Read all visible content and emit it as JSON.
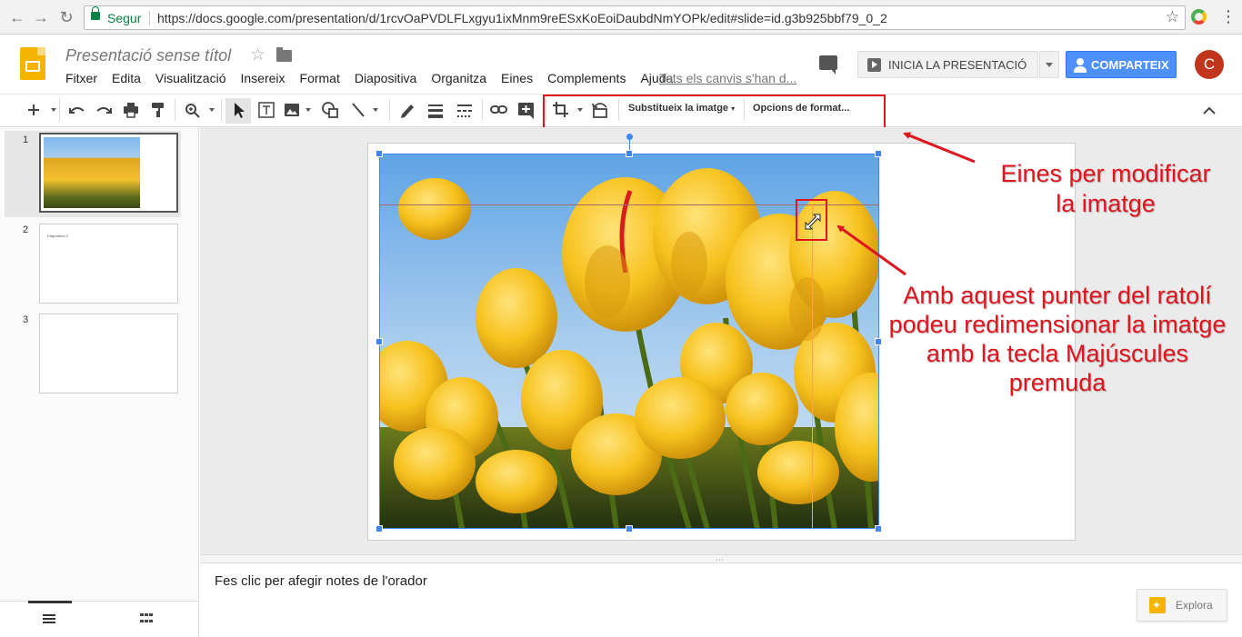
{
  "browser": {
    "secure_label": "Segur",
    "url": "https://docs.google.com/presentation/d/1rcvOaPVDLFLxgyu1ixMnm9reESxKoEoiDaubdNmYOPk/edit#slide=id.g3b925bbf79_0_2"
  },
  "doc": {
    "title": "Presentació sense títol",
    "save_status": "Tots els canvis s'han d...",
    "menu": [
      "Fitxer",
      "Edita",
      "Visualització",
      "Insereix",
      "Format",
      "Diapositiva",
      "Organitza",
      "Eines",
      "Complements",
      "Ajuda"
    ]
  },
  "header": {
    "present_label": "INICIA LA PRESENTACIÓ",
    "share_label": "COMPARTEIX",
    "avatar_initial": "C"
  },
  "toolbar": {
    "replace_image_label": "Substitueix la imatge",
    "format_options_label": "Opcions de format..."
  },
  "filmstrip": {
    "slides": [
      {
        "number": "1"
      },
      {
        "number": "2",
        "text": "Diapositiva 2"
      },
      {
        "number": "3"
      }
    ]
  },
  "notes": {
    "placeholder": "Fes clic per afegir notes de l'orador"
  },
  "explore": {
    "label": "Explora"
  },
  "annotations": {
    "tools_line1": "Eines per modificar",
    "tools_line2": "la imatge",
    "cursor_line1": "Amb aquest punter del ratolí",
    "cursor_line2": "podeu redimensionar la imatge",
    "cursor_line3": "amb la tecla Majúscules",
    "cursor_line4": "premuda"
  },
  "colors": {
    "accent_blue": "#4285f4",
    "share_blue": "#4d90fe",
    "annotation_red": "#e0141e",
    "slides_yellow": "#f4b400"
  }
}
